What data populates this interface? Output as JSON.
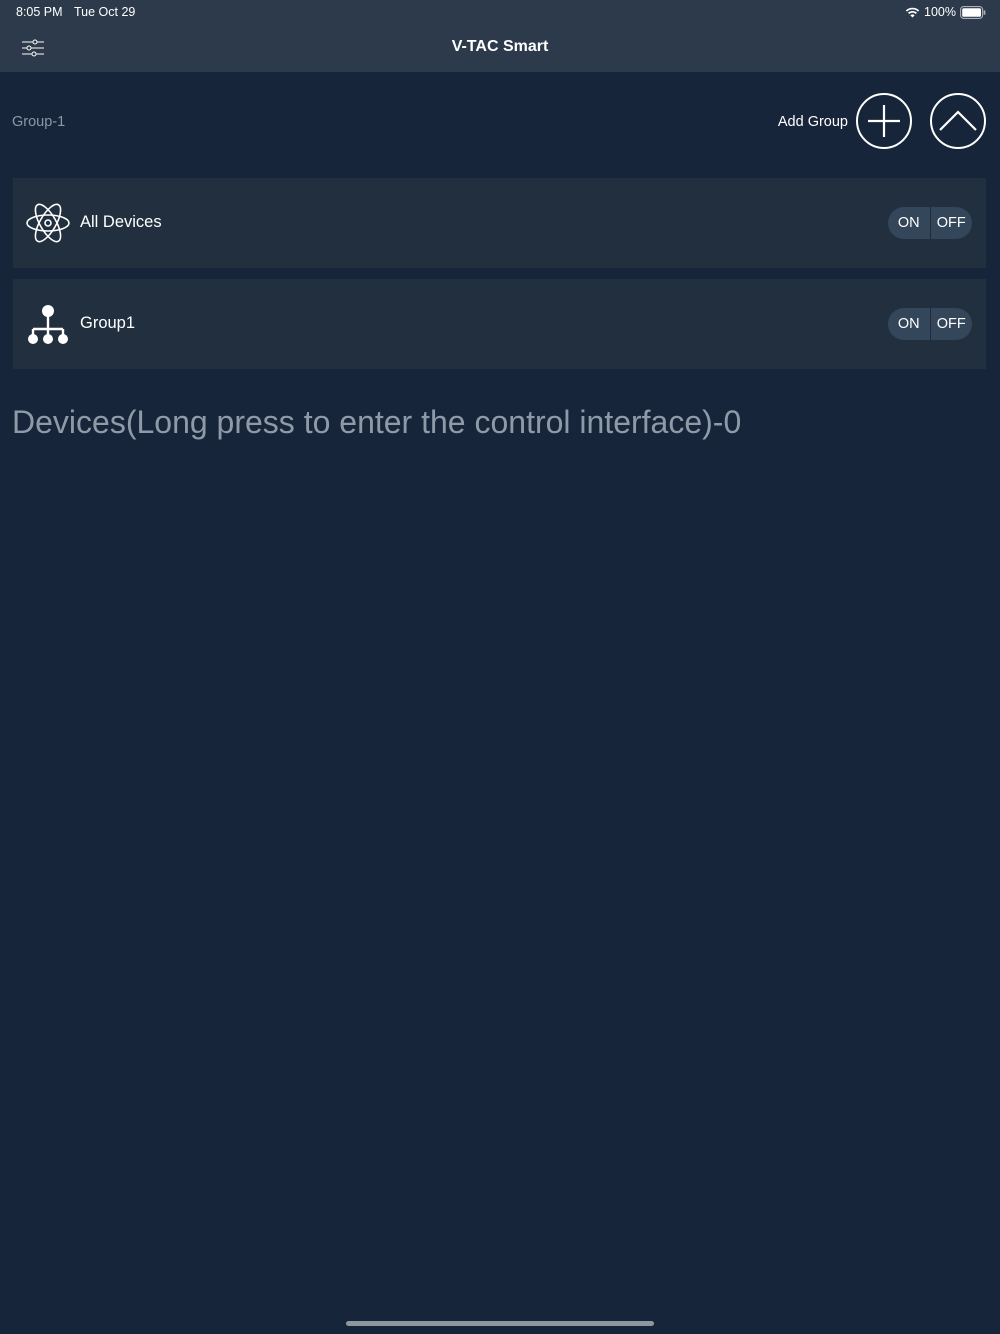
{
  "status_bar": {
    "time": "8:05 PM",
    "date": "Tue Oct 29",
    "battery": "100%"
  },
  "header": {
    "title": "V-TAC Smart"
  },
  "groups_bar": {
    "count_label": "Group-1",
    "add_label": "Add Group"
  },
  "rows": {
    "all_devices": {
      "label": "All Devices",
      "on": "ON",
      "off": "OFF"
    },
    "group1": {
      "label": "Group1",
      "on": "ON",
      "off": "OFF"
    }
  },
  "devices": {
    "heading": "Devices(Long press to enter the control interface)-0"
  },
  "colors": {
    "background": "#17253a",
    "header": "#2c3a4b",
    "row": "#222f3e",
    "toggle": "#34465a",
    "muted_text": "#8f9aa8"
  }
}
